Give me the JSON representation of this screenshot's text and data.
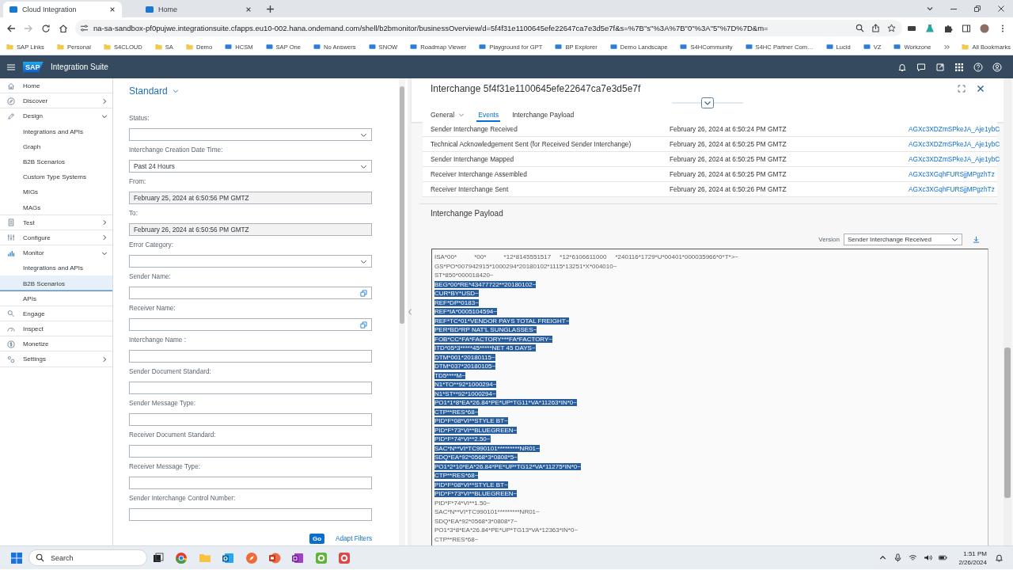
{
  "browser": {
    "tabs": [
      {
        "title": "Cloud Integration",
        "selected": true
      },
      {
        "title": "Home",
        "selected": false
      }
    ],
    "url": "na-sa-sandbox-pf0pujwe.integrationsuite.cfapps.eu10-002.hana.ondemand.com/shell/b2bmonitor/businessOverview/d=5f4f31e1100645efe22647ca7e3d5e7f&s=%7B\"s\"%3A%7B\"0\"%3A\"5\"%7D%7D&m=",
    "bookmarks": [
      {
        "label": "SAP Links",
        "kind": "folder"
      },
      {
        "label": "Personal",
        "kind": "folder"
      },
      {
        "label": "S4CLOUD",
        "kind": "folder"
      },
      {
        "label": "SA",
        "kind": "folder"
      },
      {
        "label": "Demo",
        "kind": "folder"
      },
      {
        "label": "HCSM",
        "kind": "site"
      },
      {
        "label": "SAP One",
        "kind": "site"
      },
      {
        "label": "No Answers",
        "kind": "site"
      },
      {
        "label": "SNOW",
        "kind": "site"
      },
      {
        "label": "Roadmap Viewer",
        "kind": "site"
      },
      {
        "label": "Playground for GPT",
        "kind": "site"
      },
      {
        "label": "BP Explorer",
        "kind": "site"
      },
      {
        "label": "Demo Landscape",
        "kind": "site"
      },
      {
        "label": "S4HCommunity",
        "kind": "site"
      },
      {
        "label": "S4HC Partner Com…",
        "kind": "site"
      },
      {
        "label": "Lucid",
        "kind": "site"
      },
      {
        "label": "VZ",
        "kind": "site"
      },
      {
        "label": "Workzone",
        "kind": "site"
      }
    ],
    "all_bookmarks": "All Bookmarks"
  },
  "shell": {
    "logo": "SAP",
    "product": "Integration Suite"
  },
  "nav": [
    {
      "label": "Home",
      "selected": false
    },
    {
      "label": "Discover",
      "selected": false,
      "expanded": false
    },
    {
      "label": "Design",
      "selected": false,
      "expanded": true,
      "children": [
        {
          "label": "Integrations and APIs",
          "selected": false
        },
        {
          "label": "Graph",
          "selected": false
        },
        {
          "label": "B2B Scenarios",
          "selected": false
        },
        {
          "label": "Custom Type Systems",
          "selected": false
        },
        {
          "label": "MIGs",
          "selected": false
        },
        {
          "label": "MAGs",
          "selected": false
        }
      ]
    },
    {
      "label": "Test",
      "selected": false,
      "expanded": false
    },
    {
      "label": "Configure",
      "selected": false,
      "expanded": false
    },
    {
      "label": "Monitor",
      "selected": false,
      "expanded": true,
      "children": [
        {
          "label": "Integrations and APIs",
          "selected": false
        },
        {
          "label": "B2B Scenarios",
          "selected": true
        },
        {
          "label": "APIs",
          "selected": false
        }
      ]
    },
    {
      "label": "Engage",
      "selected": false
    },
    {
      "label": "Inspect",
      "selected": false
    },
    {
      "label": "Monetize",
      "selected": false
    },
    {
      "label": "Settings",
      "selected": false,
      "expanded": false
    }
  ],
  "filters": {
    "variant": "Standard",
    "fields": [
      {
        "label": "Status:",
        "kind": "select"
      },
      {
        "label": "Interchange Creation Date Time:",
        "kind": "select",
        "value": "Past 24 Hours"
      },
      {
        "label": "From:",
        "kind": "readonly",
        "value": "February 25, 2024 at 6:50:56 PM GMTZ"
      },
      {
        "label": "To:",
        "kind": "readonly",
        "value": "February 26, 2024 at 6:50:56 PM GMTZ"
      },
      {
        "label": "Error Category:",
        "kind": "select"
      },
      {
        "label": "Sender Name:",
        "kind": "valuehelp"
      },
      {
        "label": "Receiver Name:",
        "kind": "valuehelp"
      },
      {
        "label": "Interchange Name :",
        "kind": "input"
      },
      {
        "label": "Sender Document Standard:",
        "kind": "input"
      },
      {
        "label": "Sender Message Type:",
        "kind": "input"
      },
      {
        "label": "Receiver Document Standard:",
        "kind": "input"
      },
      {
        "label": "Receiver Message Type:",
        "kind": "input"
      },
      {
        "label": "Sender Interchange Control Number:",
        "kind": "input"
      }
    ],
    "go": "Go",
    "adapt": "Adapt Filters"
  },
  "detail": {
    "title": "Interchange 5f4f31e1100645efe22647ca7e3d5e7f",
    "tabs": [
      {
        "label": "General",
        "selected": false,
        "menu": true
      },
      {
        "label": "Events",
        "selected": true,
        "menu": false
      },
      {
        "label": "Interchange Payload",
        "selected": false,
        "menu": false
      }
    ],
    "events": [
      {
        "name": "Sender Interchange Received",
        "time": "February 26, 2024 at 6:50:24 PM GMTZ",
        "id": "AGXc3XDZmSPkeJA_Aje1ybC"
      },
      {
        "name": "Technical Acknowledgement Sent (for Received Sender Interchange)",
        "time": "February 26, 2024 at 6:50:25 PM GMTZ",
        "id": "AGXc3XDZmSPkeJA_Aje1ybC"
      },
      {
        "name": "Sender Interchange Mapped",
        "time": "February 26, 2024 at 6:50:25 PM GMTZ",
        "id": "AGXc3XDZmSPkeJA_Aje1ybC"
      },
      {
        "name": "Receiver Interchange Assembled",
        "time": "February 26, 2024 at 6:50:25 PM GMTZ",
        "id": "AGXc3XGqhFURSjjMPgzhTz"
      },
      {
        "name": "Receiver Interchange Sent",
        "time": "February 26, 2024 at 6:50:26 PM GMTZ",
        "id": "AGXc3XGqhFURSjjMPgzhTz"
      }
    ],
    "payload": {
      "title": "Interchange Payload",
      "version_label": "Version",
      "version": "Sender Interchange Received",
      "lines": [
        {
          "text": "ISA*00*          *00*          *12*8145551517     *12*6106611000     *240116*1729*U*00401*000035966*0*T*>~",
          "selected": false
        },
        {
          "text": "GS*PO*007942915*1000294*20180102*1115*13251*X*004010~",
          "selected": false
        },
        {
          "text": "ST*850*000018420~",
          "selected": false
        },
        {
          "text": "BEG*00*RE*43477722**20180102~",
          "selected": true
        },
        {
          "text": "CUR*BY*USD~",
          "selected": true
        },
        {
          "text": "REF*DP*0183~",
          "selected": true
        },
        {
          "text": "REF*IA*0005104594~",
          "selected": true
        },
        {
          "text": "REF*TC*01*VENDOR PAYS TOTAL FREIGHT~",
          "selected": true
        },
        {
          "text": "PER*BD*RP NAT'L SUNGLASSES~",
          "selected": true
        },
        {
          "text": "FOB*CC*FA*FACTORY***FA*FACTORY~",
          "selected": true
        },
        {
          "text": "ITD*05*3*****45*****NET 45 DAYS~",
          "selected": true
        },
        {
          "text": "DTM*001*20180115~",
          "selected": true
        },
        {
          "text": "DTM*037*20180105~",
          "selected": true
        },
        {
          "text": "TD5****M~",
          "selected": true
        },
        {
          "text": "N1*TO**92*1000294~",
          "selected": true
        },
        {
          "text": "N1*ST**92*1000294~",
          "selected": true
        },
        {
          "text": "PO1*1*8*EA*26.84*PE*UP*TG11*VA*11263*IN*0~",
          "selected": true
        },
        {
          "text": "CTP**RES*68~",
          "selected": true
        },
        {
          "text": "PID*F*08*VI**STYLE BT~",
          "selected": true
        },
        {
          "text": "PID*F*73*VI**BLUEGREEN~",
          "selected": true
        },
        {
          "text": "PID*F*74*VI**2.50~",
          "selected": true
        },
        {
          "text": "SAC*N**VI*TC990101*********NR01~",
          "selected": true
        },
        {
          "text": "SDQ*EA*92*0568*3*0808*5~",
          "selected": true
        },
        {
          "text": "PO1*2*10*EA*26.84*PE*UP*TG12*VA*11275*IN*0~",
          "selected": true
        },
        {
          "text": "CTP**RES*68~",
          "selected": true
        },
        {
          "text": "PID*F*08*VI**STYLE BT~",
          "selected": true
        },
        {
          "text": "PID*F*73*VI**BLUEGREEN~",
          "selected": true
        },
        {
          "text": "PID*F*74*VI**1.50~",
          "selected": false
        },
        {
          "text": "SAC*N**VI*TC990101*********NR01~",
          "selected": false
        },
        {
          "text": "SDQ*EA*92*0568*3*0808*7~",
          "selected": false
        },
        {
          "text": "PO1*3*8*EA*26.84*PE*UP*TG13*VA*12363*IN*0~",
          "selected": false
        },
        {
          "text": "CTP**RES*68~",
          "selected": false
        }
      ]
    }
  },
  "taskbar": {
    "search": {
      "placeholder": "Search"
    },
    "time": "1:51 PM",
    "date": "2/26/2024"
  }
}
